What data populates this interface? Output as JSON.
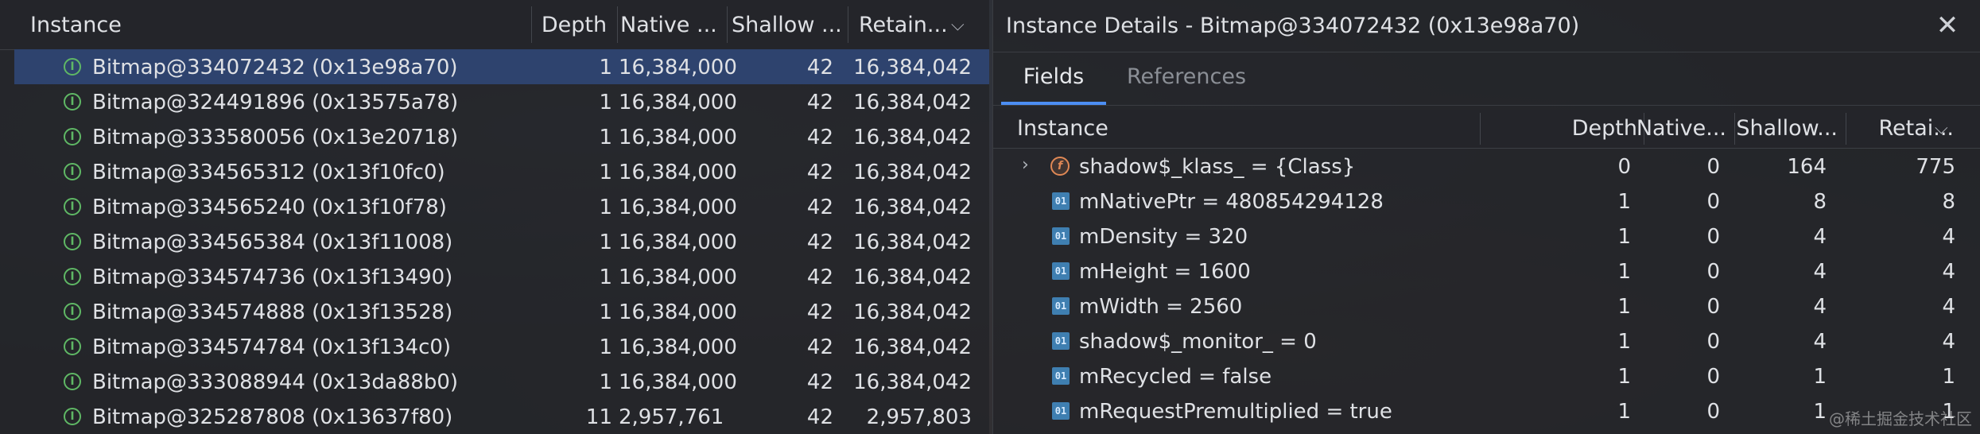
{
  "left_table": {
    "headers": {
      "instance": "Instance",
      "depth": "Depth",
      "native": "Native ...",
      "shallow": "Shallow ...",
      "retained": "Retain..."
    },
    "rows": [
      {
        "instance": "Bitmap@334072432  (0x13e98a70)",
        "depth": "1",
        "native": "16,384,000",
        "shallow": "42",
        "retained": "16,384,042",
        "selected": true
      },
      {
        "instance": "Bitmap@324491896  (0x13575a78)",
        "depth": "1",
        "native": "16,384,000",
        "shallow": "42",
        "retained": "16,384,042"
      },
      {
        "instance": "Bitmap@333580056  (0x13e20718)",
        "depth": "1",
        "native": "16,384,000",
        "shallow": "42",
        "retained": "16,384,042"
      },
      {
        "instance": "Bitmap@334565312  (0x13f10fc0)",
        "depth": "1",
        "native": "16,384,000",
        "shallow": "42",
        "retained": "16,384,042"
      },
      {
        "instance": "Bitmap@334565240  (0x13f10f78)",
        "depth": "1",
        "native": "16,384,000",
        "shallow": "42",
        "retained": "16,384,042"
      },
      {
        "instance": "Bitmap@334565384  (0x13f11008)",
        "depth": "1",
        "native": "16,384,000",
        "shallow": "42",
        "retained": "16,384,042"
      },
      {
        "instance": "Bitmap@334574736  (0x13f13490)",
        "depth": "1",
        "native": "16,384,000",
        "shallow": "42",
        "retained": "16,384,042"
      },
      {
        "instance": "Bitmap@334574888  (0x13f13528)",
        "depth": "1",
        "native": "16,384,000",
        "shallow": "42",
        "retained": "16,384,042"
      },
      {
        "instance": "Bitmap@334574784  (0x13f134c0)",
        "depth": "1",
        "native": "16,384,000",
        "shallow": "42",
        "retained": "16,384,042"
      },
      {
        "instance": "Bitmap@333088944  (0x13da88b0)",
        "depth": "1",
        "native": "16,384,000",
        "shallow": "42",
        "retained": "16,384,042"
      },
      {
        "instance": "Bitmap@325287808  (0x13637f80)",
        "depth": "11",
        "native": "2,957,761",
        "shallow": "42",
        "retained": "2,957,803"
      }
    ]
  },
  "details": {
    "title": "Instance Details - Bitmap@334072432  (0x13e98a70)",
    "tabs": [
      "Fields",
      "References"
    ],
    "headers": {
      "instance": "Instance",
      "depth": "Depth",
      "native": "Native...",
      "shallow": "Shallow...",
      "retained": "Retai..."
    },
    "rows": [
      {
        "field": "shadow$_klass_ = {Class}",
        "icon": "f",
        "depth": "0",
        "native": "0",
        "shallow": "164",
        "retained": "775"
      },
      {
        "field": "mNativePtr = 480854294128",
        "icon": "01",
        "depth": "1",
        "native": "0",
        "shallow": "8",
        "retained": "8"
      },
      {
        "field": "mDensity = 320",
        "icon": "01",
        "depth": "1",
        "native": "0",
        "shallow": "4",
        "retained": "4"
      },
      {
        "field": "mHeight = 1600",
        "icon": "01",
        "depth": "1",
        "native": "0",
        "shallow": "4",
        "retained": "4"
      },
      {
        "field": "mWidth = 2560",
        "icon": "01",
        "depth": "1",
        "native": "0",
        "shallow": "4",
        "retained": "4"
      },
      {
        "field": "shadow$_monitor_ = 0",
        "icon": "01",
        "depth": "1",
        "native": "0",
        "shallow": "4",
        "retained": "4"
      },
      {
        "field": "mRecycled = false",
        "icon": "01",
        "depth": "1",
        "native": "0",
        "shallow": "1",
        "retained": "1"
      },
      {
        "field": "mRequestPremultiplied = true",
        "icon": "01",
        "depth": "1",
        "native": "0",
        "shallow": "1",
        "retained": "1"
      }
    ]
  },
  "watermark": "@稀土掘金技术社区",
  "colors": {
    "selection": "#2e436e",
    "accent": "#4c8ef3",
    "instance_icon": "#5fb865",
    "field_icon": "#e08855",
    "primitive_icon": "#3f7fb1"
  }
}
